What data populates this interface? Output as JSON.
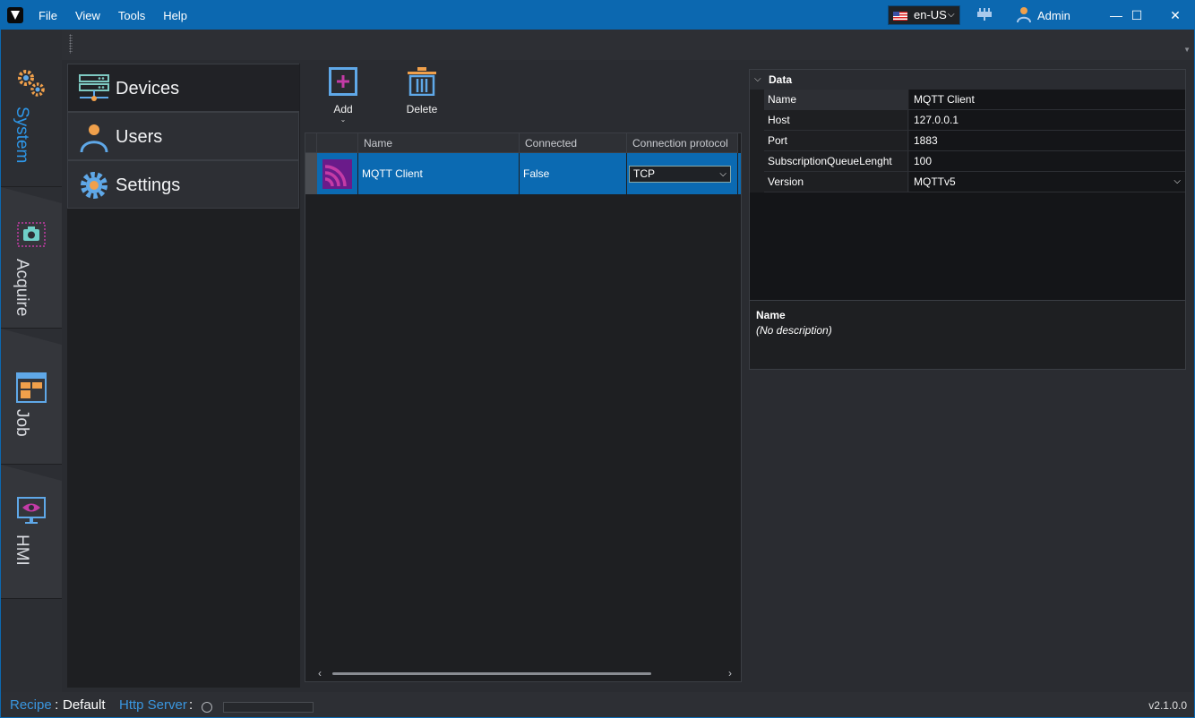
{
  "titlebar": {
    "menu": [
      "File",
      "View",
      "Tools",
      "Help"
    ],
    "language": "en-US",
    "user": "Admin",
    "window_controls": {
      "minimize": "—",
      "maximize": "☐",
      "close": "✕"
    }
  },
  "leftnav": {
    "tabs": [
      {
        "label": "System",
        "icon": "gears-icon",
        "active": true
      },
      {
        "label": "Acquire",
        "icon": "camera-icon"
      },
      {
        "label": "Job",
        "icon": "job-layout-icon"
      },
      {
        "label": "HMI",
        "icon": "monitor-eye-icon"
      }
    ]
  },
  "sidemenu": {
    "items": [
      {
        "label": "Devices",
        "icon": "server-icon",
        "active": true
      },
      {
        "label": "Users",
        "icon": "user-icon"
      },
      {
        "label": "Settings",
        "icon": "gear-icon"
      }
    ]
  },
  "toolbar": {
    "add_label": "Add",
    "delete_label": "Delete"
  },
  "devices_grid": {
    "columns": [
      "Name",
      "Connected",
      "Connection protocol"
    ],
    "rows": [
      {
        "icon": "mqtt-icon",
        "name": "MQTT Client",
        "connected": "False",
        "protocol": "TCP"
      }
    ]
  },
  "properties": {
    "category": "Data",
    "rows": [
      {
        "name": "Name",
        "value": "MQTT Client"
      },
      {
        "name": "Host",
        "value": "127.0.0.1"
      },
      {
        "name": "Port",
        "value": "1883"
      },
      {
        "name": "SubscriptionQueueLenght",
        "value": "100"
      },
      {
        "name": "Version",
        "value": "MQTTv5"
      }
    ],
    "description_title": "Name",
    "description_text": "(No description)"
  },
  "statusbar": {
    "recipe_label": "Recipe",
    "recipe_sep": " : ",
    "recipe_value": "Default",
    "http_label": "Http Server",
    "http_sep": " :",
    "version": "v2.1.0.0"
  },
  "colors": {
    "accent": "#0c68b0",
    "selection": "#0b6ab2",
    "link": "#3a96df",
    "icon_orange": "#f0a04b",
    "icon_blue": "#5fa8e8",
    "icon_magenta": "#c43ba6"
  }
}
